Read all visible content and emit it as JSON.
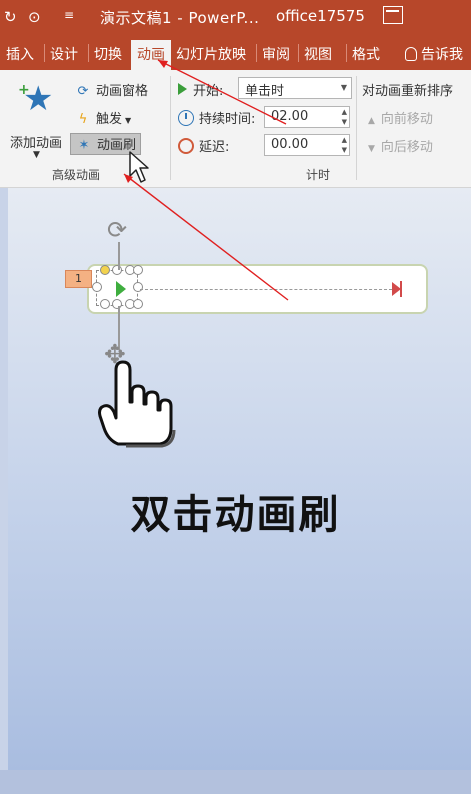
{
  "titlebar": {
    "title": "演示文稿1 - PowerP...",
    "account": "office17575",
    "quick_access": [
      "↻",
      "⊙",
      "≡"
    ]
  },
  "tabs": [
    {
      "label": "插入",
      "active": false
    },
    {
      "label": "设计",
      "active": false
    },
    {
      "label": "切换",
      "active": false
    },
    {
      "label": "动画",
      "active": true
    },
    {
      "label": "幻灯片放映",
      "active": false
    },
    {
      "label": "审阅",
      "active": false
    },
    {
      "label": "视图",
      "active": false
    },
    {
      "label": "格式",
      "active": false
    }
  ],
  "tell_me": "告诉我",
  "ribbon": {
    "add_animation": "添加动画",
    "animation_pane": "动画窗格",
    "trigger": "触发",
    "animation_painter": "动画刷",
    "advanced_group": "高级动画",
    "start_label": "开始:",
    "start_value": "单击时",
    "duration_label": "持续时间:",
    "duration_value": "02.00",
    "delay_label": "延迟:",
    "delay_value": "00.00",
    "timing_group": "计时",
    "reorder_title": "对动画重新排序",
    "move_earlier": "向前移动",
    "move_later": "向后移动"
  },
  "slide": {
    "animation_number": "1",
    "caption": "双击动画刷"
  },
  "colors": {
    "accent": "#b7472a",
    "arrow_red": "#e02020"
  }
}
